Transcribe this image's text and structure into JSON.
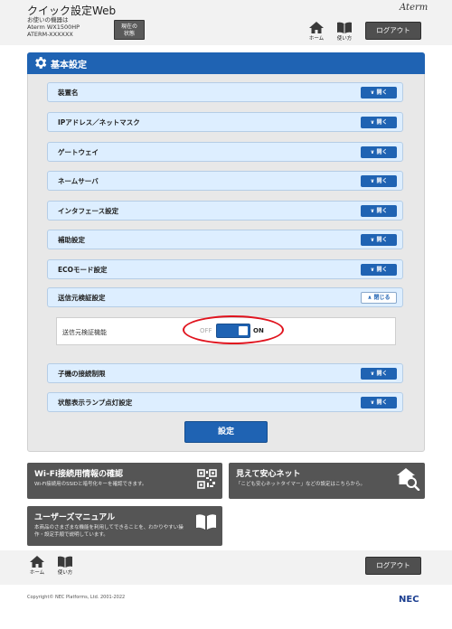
{
  "header": {
    "title": "クイック設定Web",
    "device_caption": "お使いの機器は",
    "model": "Aterm  WX1500HP",
    "ssid": "ATERM-XXXXXX",
    "status_button": [
      "現在の",
      "状態"
    ],
    "brand": "Aterm",
    "home_label": "ホーム",
    "manual_label": "使い方",
    "logout_label": "ログアウト"
  },
  "panel": {
    "title": "基本設定",
    "open_label": "開く",
    "close_label": "閉じる",
    "rows": [
      {
        "label": "装置名"
      },
      {
        "label": "IPアドレス／ネットマスク"
      },
      {
        "label": "ゲートウェイ"
      },
      {
        "label": "ネームサーバ"
      },
      {
        "label": "インタフェース設定"
      },
      {
        "label": "補助設定"
      },
      {
        "label": "ECOモード設定"
      },
      {
        "label": "送信元検証設定"
      },
      {
        "label": "子機の接続制限"
      },
      {
        "label": "状態表示ランプ点灯設定"
      }
    ],
    "sub_setting": {
      "label": "送信元検証機能",
      "off_label": "OFF",
      "on_label": "ON",
      "value": "ON"
    },
    "submit_label": "設定"
  },
  "cards": {
    "wifi": {
      "title": "Wi-Fi接続用情報の確認",
      "desc": "Wi-Fi接続用のSSIDと暗号化キーを確認できます。"
    },
    "safe": {
      "title": "見えて安心ネット",
      "desc": "「こども安心ネットタイマー」などの設定はこちらから。"
    },
    "manual": {
      "title": "ユーザーズマニュアル",
      "desc1": "本商品のさまざまな機能を利用してできることを、わかりやすい操",
      "desc2": "作・設定手順で説明しています。"
    }
  },
  "footer": {
    "home_label": "ホーム",
    "manual_label": "使い方",
    "logout_label": "ログアウト",
    "copyright": "Copyright© NEC Platforms, Ltd. 2001-2022",
    "logo": "NEC"
  }
}
